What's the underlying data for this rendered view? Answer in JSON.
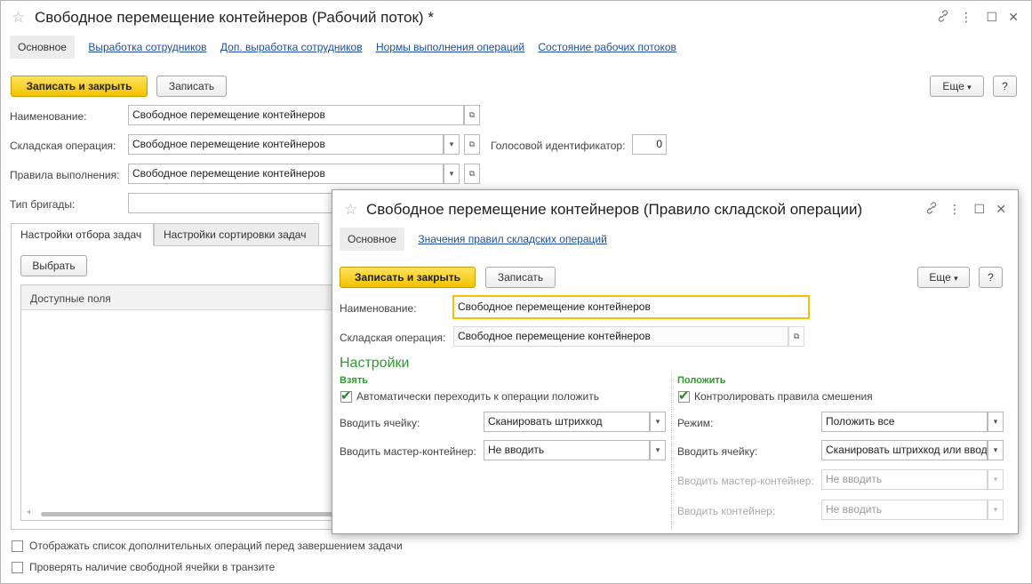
{
  "main": {
    "title": "Свободное перемещение контейнеров (Рабочий поток) *",
    "tabs": [
      "Основное",
      "Выработка сотрудников",
      "Доп. выработка сотрудников",
      "Нормы выполнения операций",
      "Состояние рабочих потоков"
    ],
    "buttons": {
      "save_close": "Записать и закрыть",
      "save": "Записать",
      "more": "Еще",
      "help": "?"
    },
    "fields": {
      "name_label": "Наименование:",
      "name_value": "Свободное перемещение контейнеров",
      "operation_label": "Складская операция:",
      "operation_value": "Свободное перемещение контейнеров",
      "voice_label": "Голосовой идентификатор:",
      "voice_value": "0",
      "rules_label": "Правила выполнения:",
      "rules_value": "Свободное перемещение контейнеров",
      "brigade_label": "Тип бригады:",
      "brigade_value": ""
    },
    "inner_tabs": [
      "Настройки отбора задач",
      "Настройки сортировки задач"
    ],
    "select_button": "Выбрать",
    "available_fields": "Доступные поля",
    "checkboxes": [
      {
        "label": "Отображать список дополнительных операций перед завершением задачи",
        "checked": false
      },
      {
        "label": "Проверять наличие свободной ячейки в транзите",
        "checked": false
      }
    ]
  },
  "dialog": {
    "title": "Свободное перемещение контейнеров (Правило складской операции)",
    "tabs": [
      "Основное",
      "Значения правил складских операций"
    ],
    "buttons": {
      "save_close": "Записать и закрыть",
      "save": "Записать",
      "more": "Еще",
      "help": "?"
    },
    "name_label": "Наименование:",
    "name_value": "Свободное перемещение контейнеров",
    "operation_label": "Складская операция:",
    "operation_value": "Свободное перемещение контейнеров",
    "settings_title": "Настройки",
    "take": {
      "title": "Взять",
      "auto_label": "Автоматически переходить к операции положить",
      "auto_checked": true,
      "cell_label": "Вводить ячейку:",
      "cell_value": "Сканировать штрихкод",
      "master_label": "Вводить мастер-контейнер:",
      "master_value": "Не вводить"
    },
    "put": {
      "title": "Положить",
      "control_label": "Контролировать правила смешения",
      "control_checked": true,
      "mode_label": "Режим:",
      "mode_value": "Положить все",
      "cell_label": "Вводить ячейку:",
      "cell_value": "Сканировать штрихкод или вводить",
      "master_label": "Вводить мастер-контейнер:",
      "master_value": "Не вводить",
      "container_label": "Вводить контейнер:",
      "container_value": "Не вводить"
    }
  },
  "icons": {
    "star": "☆",
    "link": "🔗",
    "more": "⋮",
    "maximize": "☐",
    "close": "✕",
    "dropdown": "▾",
    "open": "⧉",
    "check": "✔"
  },
  "colors": {
    "accent_yellow": "#f5c800",
    "link_blue": "#1d4fa0",
    "section_green": "#2f9a2f"
  }
}
